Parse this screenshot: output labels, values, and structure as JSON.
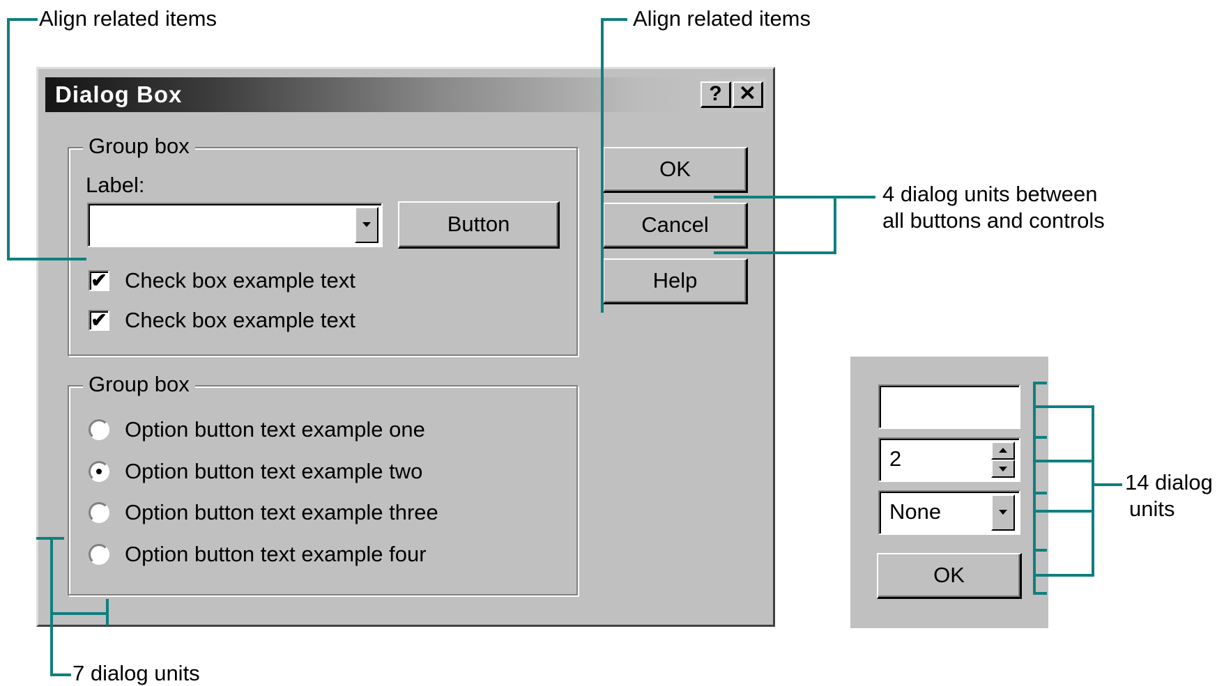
{
  "annotations": {
    "align_left": "Align related items",
    "align_right": "Align related items",
    "four_units_line1": "4 dialog units between",
    "four_units_line2": "all buttons and controls",
    "fourteen_line1": "14 dialog",
    "fourteen_line2": "units",
    "seven_units": "7 dialog units"
  },
  "dialog": {
    "title": "Dialog Box",
    "help_glyph": "?",
    "close_glyph": "✕",
    "group1": {
      "title": "Group box",
      "label": "Label:",
      "combo_value": "",
      "button_label": "Button",
      "checkboxes": [
        {
          "label": "Check box example text",
          "checked": true
        },
        {
          "label": "Check box example text",
          "checked": true
        }
      ]
    },
    "group2": {
      "title": "Group box",
      "options": [
        {
          "label": "Option button text example one",
          "selected": false
        },
        {
          "label": "Option button text example two",
          "selected": true
        },
        {
          "label": "Option button text example three",
          "selected": false
        },
        {
          "label": "Option button text example four",
          "selected": false
        }
      ]
    },
    "buttons": {
      "ok": "OK",
      "cancel": "Cancel",
      "help": "Help"
    }
  },
  "panel": {
    "text_value": "",
    "spinner_value": "2",
    "dropdown_value": "None",
    "ok_label": "OK"
  },
  "colors": {
    "annotation_line": "#0f7f7f",
    "dialog_face": "#c0c0c0"
  },
  "icons": [
    "help-icon",
    "close-icon",
    "dropdown-arrow-icon",
    "spin-up-icon",
    "spin-down-icon",
    "checkmark-icon"
  ]
}
